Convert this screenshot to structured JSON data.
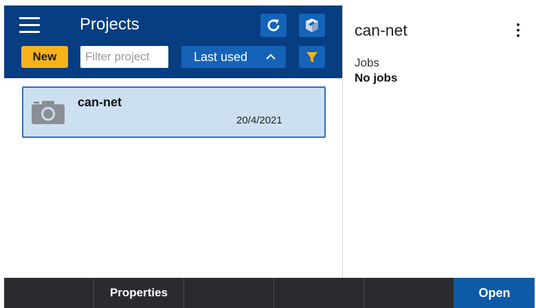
{
  "header": {
    "title": "Projects",
    "new_label": "New",
    "filter_placeholder": "Filter project",
    "sort_label": "Last used"
  },
  "projects": [
    {
      "name": "can-net",
      "date": "20/4/2021"
    }
  ],
  "details": {
    "title": "can-net",
    "jobs_label": "Jobs",
    "jobs_value": "No jobs"
  },
  "bottombar": {
    "properties_label": "Properties",
    "open_label": "Open"
  },
  "colors": {
    "header": "#073e82",
    "button": "#1563b8",
    "accent": "#f7b21a",
    "selected_row": "#cde0f1",
    "bottombar": "#2b2b2f",
    "open_button": "#0d5ba7"
  },
  "icons": [
    "menu-icon",
    "refresh-icon",
    "cube-icon",
    "chevron-up-icon",
    "filter-icon",
    "camera-icon",
    "more-vert-icon"
  ]
}
